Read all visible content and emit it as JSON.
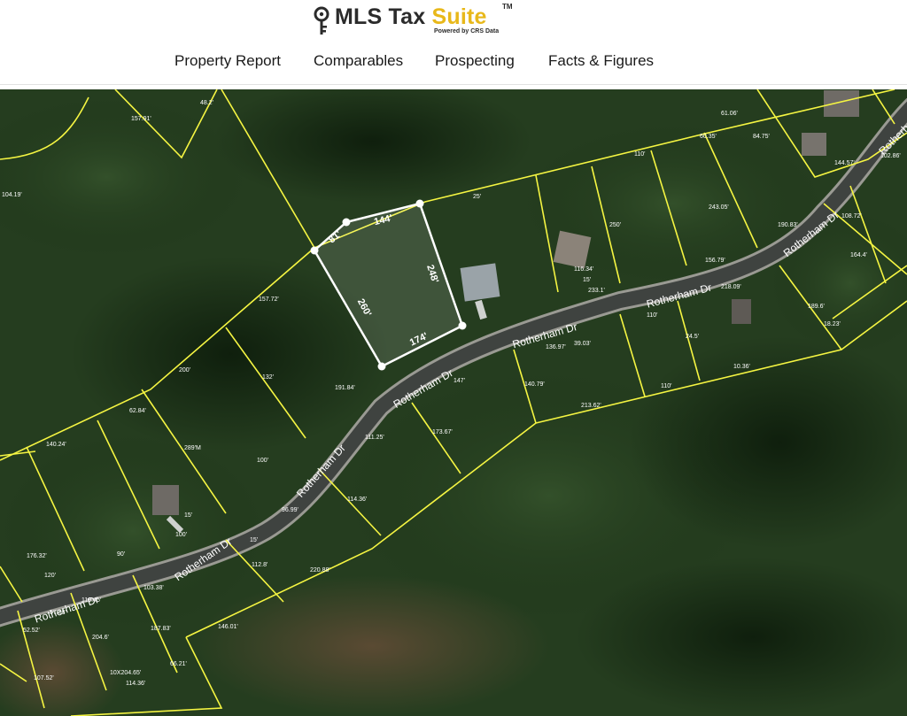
{
  "brand": {
    "name_main": "MLS Tax ",
    "name_accent": "Suite",
    "trademark": "TM",
    "tagline": "Powered by CRS Data",
    "accent_color": "#e8b81a"
  },
  "nav": {
    "items": [
      {
        "label": "Property Report"
      },
      {
        "label": "Comparables"
      },
      {
        "label": "Prospecting"
      },
      {
        "label": "Facts & Figures"
      }
    ]
  },
  "map": {
    "parcel_line_color": "#f5f542",
    "selected_parcel_color": "#ffffff",
    "selected_parcel": {
      "edges": [
        "81'",
        "144'",
        "248'",
        "174'",
        "260'"
      ]
    },
    "street_labels": [
      "Rotherham Dr",
      "Rotherham Dr",
      "Rotherham Dr",
      "Rotherham Dr",
      "Rotherham Dr",
      "Rotherham Dr",
      "Rotherham Dr"
    ],
    "dimension_labels": [
      "157.91'",
      "48.2'",
      "104.19'",
      "60.35'",
      "61.06'",
      "84.75'",
      "110'",
      "25'",
      "250'",
      "243.05'",
      "102.86'",
      "144.57'",
      "190.83'",
      "108.72'",
      "164.4'",
      "156.79'",
      "116.34'",
      "15'",
      "233.1'",
      "157.72'",
      "200'",
      "132'",
      "191.84'",
      "136.97'",
      "39.03'",
      "110'",
      "24.5'",
      "218.09'",
      "189.6'",
      "18.23'",
      "10.36'",
      "147'",
      "140.79'",
      "213.62'",
      "110'",
      "62.84'",
      "140.24'",
      "289'M",
      "100'",
      "111.25'",
      "173.67'",
      "114.36'",
      "96.99'",
      "15'",
      "15'",
      "100'",
      "176.32'",
      "90'",
      "120'",
      "112.8'",
      "220.88'",
      "57.68'",
      "119.45'",
      "103.38'",
      "52.52'",
      "204.6'",
      "187.83'",
      "10X204.65'",
      "114.36'",
      "66.21'",
      "146.01'",
      "107.52'"
    ]
  }
}
